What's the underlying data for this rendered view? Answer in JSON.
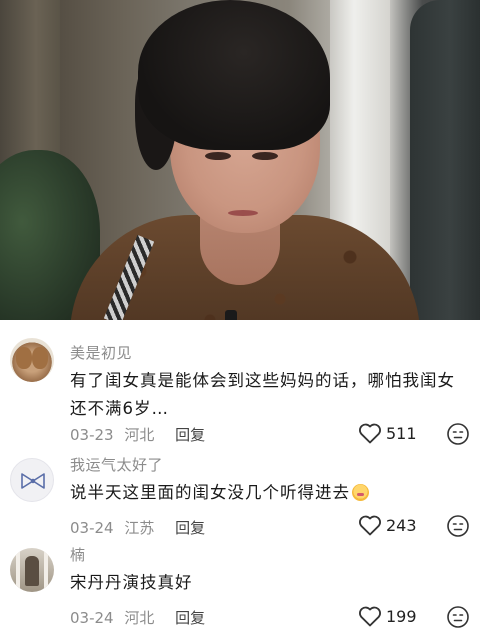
{
  "comments": [
    {
      "username": "美是初见",
      "text": "有了闺女真是能体会到这些妈妈的话，哪怕我闺女还不满6岁…",
      "date": "03-23",
      "location": "河北",
      "reply_label": "回复",
      "likes": "511",
      "avatar_icon": "teddy-bears-avatar-icon"
    },
    {
      "username": "我运气太好了",
      "text": "说半天这里面的闺女没几个听得进去",
      "emoji": "crying-face-emoji",
      "date": "03-24",
      "location": "江苏",
      "reply_label": "回复",
      "likes": "243",
      "avatar_icon": "bow-avatar-icon"
    },
    {
      "username": "楠",
      "text": "宋丹丹演技真好",
      "date": "03-24",
      "location": "河北",
      "reply_label": "回复",
      "likes": "199",
      "avatar_icon": "photo-avatar-icon"
    }
  ],
  "colors": {
    "muted": "#8c8c8c",
    "text": "#1a1a1a",
    "background": "#ffffff"
  }
}
